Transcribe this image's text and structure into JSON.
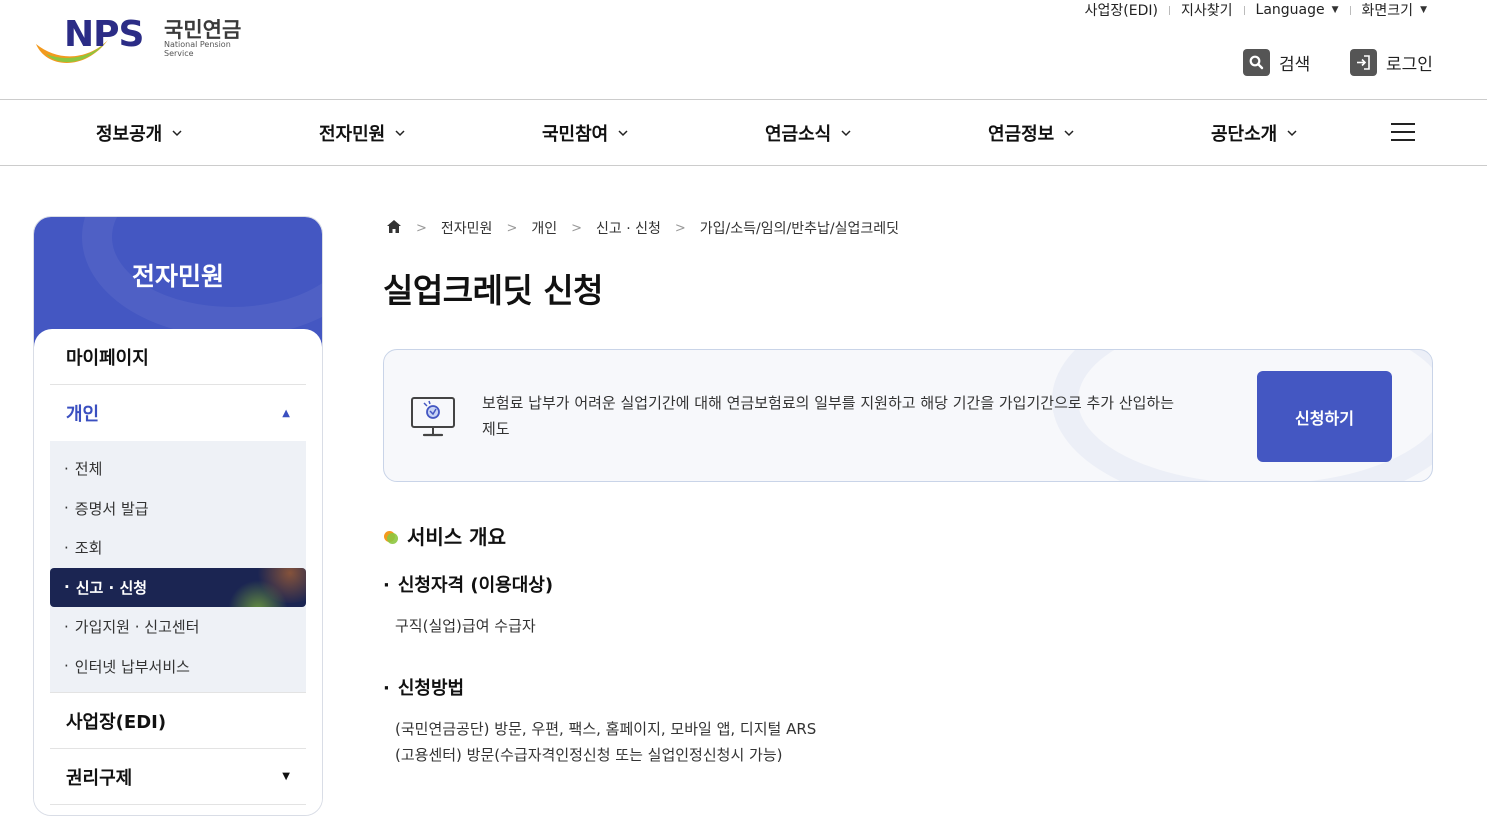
{
  "header": {
    "logo": {
      "mark": "NPS",
      "name_kr": "국민연금",
      "name_en": "National Pension Service"
    },
    "util": [
      "사업장(EDI)",
      "지사찾기",
      "Language",
      "화면크기"
    ],
    "search_label": "검색",
    "login_label": "로그인"
  },
  "gnb": {
    "items": [
      "정보공개",
      "전자민원",
      "국민참여",
      "연금소식",
      "연금정보",
      "공단소개"
    ]
  },
  "sidebar": {
    "title": "전자민원",
    "items": [
      "마이페이지",
      "개인",
      "사업장(EDI)",
      "권리구제"
    ],
    "sub_items": [
      "전체",
      "증명서 발급",
      "조회",
      "신고 · 신청",
      "가입지원 · 신고센터",
      "인터넷 납부서비스"
    ],
    "active_sub_index": 3
  },
  "breadcrumb": [
    "전자민원",
    "개인",
    "신고 · 신청",
    "가입/소득/임의/반추납/실업크레딧"
  ],
  "page": {
    "title": "실업크레딧 신청",
    "summary_line1": "보험료 납부가 어려운 실업기간에 대해 연금보험료의 일부를 지원하고 해당 기간을 가입기간으로 추가 산입하는",
    "summary_line2": "제도",
    "apply_label": "신청하기",
    "section_title": "서비스 개요",
    "eligibility_title": "신청자격 (이용대상)",
    "eligibility_text": "구직(실업)급여 수급자",
    "method_title": "신청방법",
    "method_line1": "(국민연금공단) 방문, 우편, 팩스, 홈페이지, 모바일 앱, 디지털 ARS",
    "method_line2": "(고용센터) 방문(수급자격인정신청 또는 실업인정신청시 가능)"
  },
  "colors": {
    "primary": "#4457c2",
    "active_bg": "#1b2552",
    "brand_navy": "#2b2c86"
  }
}
